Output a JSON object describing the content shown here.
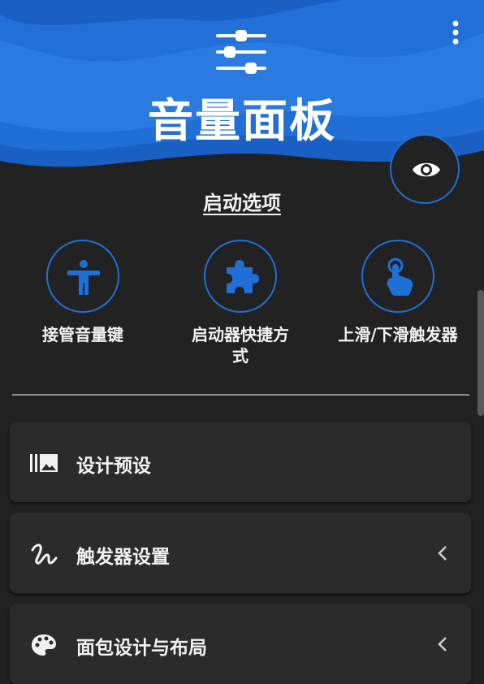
{
  "header": {
    "title": "音量面板",
    "accent_color": "#1f6fd6",
    "icons": [
      "sliders-icon",
      "more-vert-icon",
      "eye-icon"
    ]
  },
  "section": {
    "title": "启动选项"
  },
  "options": [
    {
      "label": "接管音量键",
      "icon": "accessibility-icon"
    },
    {
      "label": "启动器快捷方式",
      "icon": "puzzle-piece-icon"
    },
    {
      "label": "上滑/下滑触发器",
      "icon": "touch-hand-icon"
    }
  ],
  "menu": [
    {
      "label": "设计预设",
      "icon": "image-gallery-icon",
      "expandable": false
    },
    {
      "label": "触发器设置",
      "icon": "gesture-icon",
      "expandable": true
    },
    {
      "label": "面包设计与布局",
      "icon": "palette-icon",
      "expandable": true
    }
  ]
}
